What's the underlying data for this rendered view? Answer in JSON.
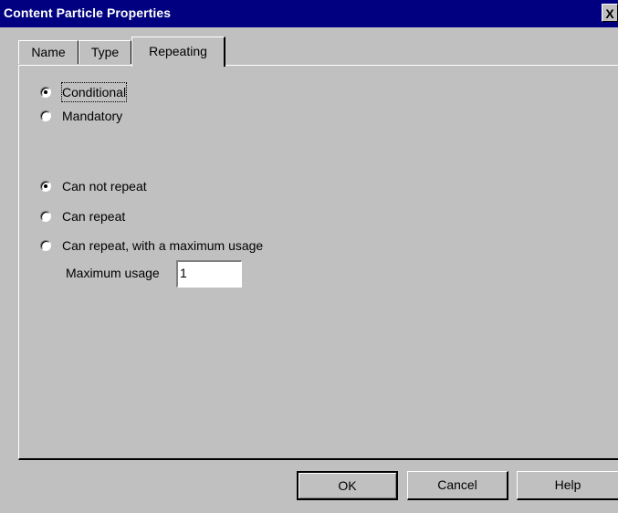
{
  "window": {
    "title": "Content Particle Properties",
    "close_label": "X"
  },
  "tabs": [
    {
      "label": "Name"
    },
    {
      "label": "Type"
    },
    {
      "label": "Repeating",
      "selected": true
    }
  ],
  "occurrence": {
    "options": [
      {
        "label": "Conditional",
        "checked": true
      },
      {
        "label": "Mandatory",
        "checked": false
      }
    ]
  },
  "repeat": {
    "options": [
      {
        "label": "Can not repeat",
        "checked": true
      },
      {
        "label": "Can repeat",
        "checked": false
      },
      {
        "label": "Can repeat, with a maximum usage",
        "checked": false
      }
    ],
    "max_usage_label": "Maximum usage",
    "max_usage_value": "1"
  },
  "buttons": {
    "ok": "OK",
    "cancel": "Cancel",
    "help": "Help"
  }
}
